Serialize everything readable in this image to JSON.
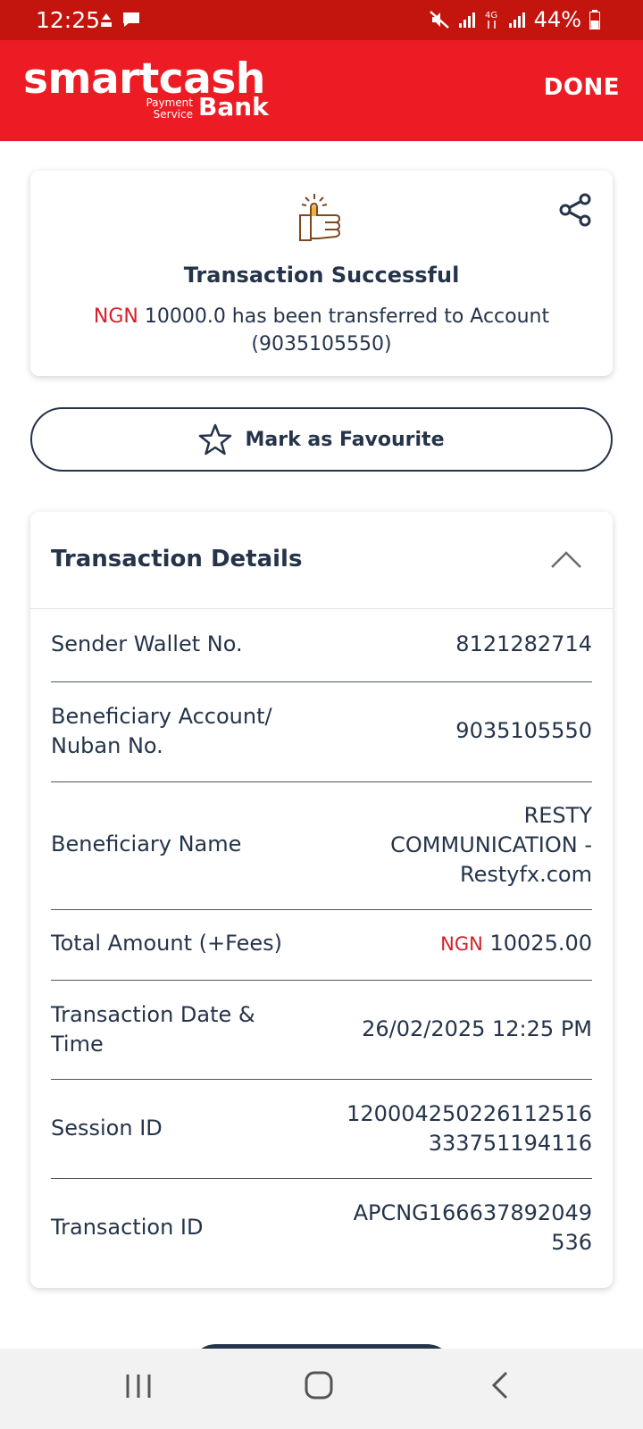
{
  "status_bar": {
    "time": "12:25",
    "battery": "44%",
    "network": "4G"
  },
  "app_bar": {
    "logo_main": "smartcash",
    "logo_sub_line1": "Payment",
    "logo_sub_line2": "Service",
    "logo_bank": "Bank",
    "done_label": "DONE"
  },
  "success": {
    "title": "Transaction Successful",
    "currency": "NGN",
    "message_amount": " 10000.0 has been transferred to Account",
    "account": "(9035105550)"
  },
  "favourite": {
    "label": "Mark as Favourite"
  },
  "details": {
    "title": "Transaction Details",
    "rows": [
      {
        "label": "Sender Wallet No.",
        "value": "8121282714"
      },
      {
        "label": "Beneficiary Account/ Nuban No.",
        "value": "9035105550"
      },
      {
        "label": "Beneficiary Name",
        "value": "RESTY COMMUNICATION - Restyfx.com"
      },
      {
        "label": "Total Amount (+Fees)",
        "currency": "NGN",
        "value": "10025.00"
      },
      {
        "label": "Transaction Date & Time",
        "value": "26/02/2025 12:25 PM"
      },
      {
        "label": "Session ID",
        "value_line1": "120004250226112516",
        "value_line2": "333751194116"
      },
      {
        "label": "Transaction ID",
        "value_line1": "APCNG166637892049",
        "value_line2": "536"
      }
    ]
  },
  "colors": {
    "brand_red": "#ed1c24",
    "status_red": "#c3140d",
    "text_navy": "#25344a",
    "currency_red": "#d6202a"
  }
}
